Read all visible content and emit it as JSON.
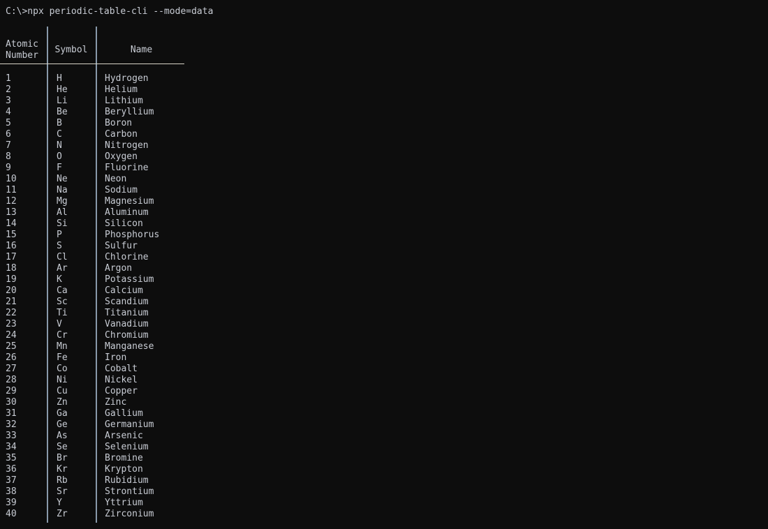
{
  "terminal": {
    "prompt": "C:\\>",
    "command": "npx periodic-table-cli --mode=data",
    "prompt_line": "C:\\>npx periodic-table-cli --mode=data",
    "background_color": "#0d0d0d",
    "text_color": "#c8ccd4",
    "rule_color": "#8899aa",
    "header_rule_color": "#d8d4c8"
  },
  "table": {
    "headers": {
      "atomic_number_line1": "Atomic",
      "atomic_number_line2": "Number",
      "symbol": "Symbol",
      "name": "Name"
    },
    "rows": [
      {
        "number": "1",
        "symbol": "H",
        "name": "Hydrogen"
      },
      {
        "number": "2",
        "symbol": "He",
        "name": "Helium"
      },
      {
        "number": "3",
        "symbol": "Li",
        "name": "Lithium"
      },
      {
        "number": "4",
        "symbol": "Be",
        "name": "Beryllium"
      },
      {
        "number": "5",
        "symbol": "B",
        "name": "Boron"
      },
      {
        "number": "6",
        "symbol": "C",
        "name": "Carbon"
      },
      {
        "number": "7",
        "symbol": "N",
        "name": "Nitrogen"
      },
      {
        "number": "8",
        "symbol": "O",
        "name": "Oxygen"
      },
      {
        "number": "9",
        "symbol": "F",
        "name": "Fluorine"
      },
      {
        "number": "10",
        "symbol": "Ne",
        "name": "Neon"
      },
      {
        "number": "11",
        "symbol": "Na",
        "name": "Sodium"
      },
      {
        "number": "12",
        "symbol": "Mg",
        "name": "Magnesium"
      },
      {
        "number": "13",
        "symbol": "Al",
        "name": "Aluminum"
      },
      {
        "number": "14",
        "symbol": "Si",
        "name": "Silicon"
      },
      {
        "number": "15",
        "symbol": "P",
        "name": "Phosphorus"
      },
      {
        "number": "16",
        "symbol": "S",
        "name": "Sulfur"
      },
      {
        "number": "17",
        "symbol": "Cl",
        "name": "Chlorine"
      },
      {
        "number": "18",
        "symbol": "Ar",
        "name": "Argon"
      },
      {
        "number": "19",
        "symbol": "K",
        "name": "Potassium"
      },
      {
        "number": "20",
        "symbol": "Ca",
        "name": "Calcium"
      },
      {
        "number": "21",
        "symbol": "Sc",
        "name": "Scandium"
      },
      {
        "number": "22",
        "symbol": "Ti",
        "name": "Titanium"
      },
      {
        "number": "23",
        "symbol": "V",
        "name": "Vanadium"
      },
      {
        "number": "24",
        "symbol": "Cr",
        "name": "Chromium"
      },
      {
        "number": "25",
        "symbol": "Mn",
        "name": "Manganese"
      },
      {
        "number": "26",
        "symbol": "Fe",
        "name": "Iron"
      },
      {
        "number": "27",
        "symbol": "Co",
        "name": "Cobalt"
      },
      {
        "number": "28",
        "symbol": "Ni",
        "name": "Nickel"
      },
      {
        "number": "29",
        "symbol": "Cu",
        "name": "Copper"
      },
      {
        "number": "30",
        "symbol": "Zn",
        "name": "Zinc"
      },
      {
        "number": "31",
        "symbol": "Ga",
        "name": "Gallium"
      },
      {
        "number": "32",
        "symbol": "Ge",
        "name": "Germanium"
      },
      {
        "number": "33",
        "symbol": "As",
        "name": "Arsenic"
      },
      {
        "number": "34",
        "symbol": "Se",
        "name": "Selenium"
      },
      {
        "number": "35",
        "symbol": "Br",
        "name": "Bromine"
      },
      {
        "number": "36",
        "symbol": "Kr",
        "name": "Krypton"
      },
      {
        "number": "37",
        "symbol": "Rb",
        "name": "Rubidium"
      },
      {
        "number": "38",
        "symbol": "Sr",
        "name": "Strontium"
      },
      {
        "number": "39",
        "symbol": "Y",
        "name": "Yttrium"
      },
      {
        "number": "40",
        "symbol": "Zr",
        "name": "Zirconium"
      }
    ]
  }
}
